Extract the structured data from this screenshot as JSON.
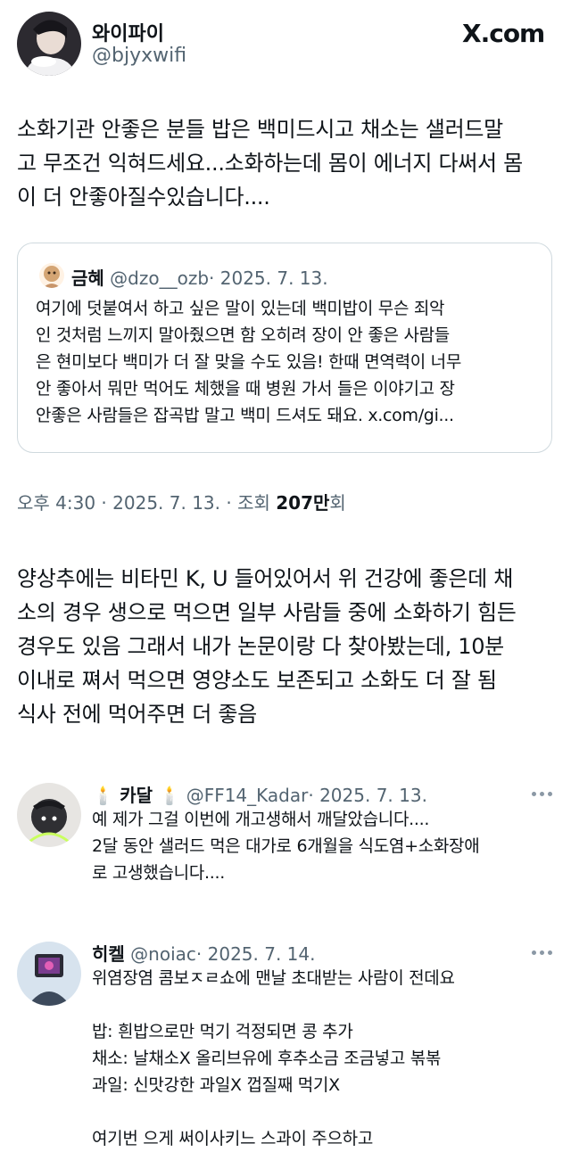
{
  "header": {
    "display_name": "와이파이",
    "handle": "@bjyxwifi",
    "brand": "X.com"
  },
  "post": {
    "lines": [
      "소화기관 안좋은 분들 밥은 백미드시고 채소는 샐러드말",
      "고 무조건 익혀드세요...소화하는데 몸이 에너지 다써서 몸",
      "이 더 안좋아질수있습니다...."
    ],
    "meta_time": "오후 4:30 · 2025. 7. 13. · 조회 ",
    "meta_views": "207만",
    "meta_unit": "회"
  },
  "quote": {
    "name": "금혜",
    "handle": "@dzo__ozb",
    "date": "· 2025. 7. 13.",
    "lines": [
      "여기에 덧붙여서 하고 싶은 말이 있는데 백미밥이 무슨 죄악",
      "인 것처럼 느끼지 말아줬으면 함 오히려 장이 안 좋은 사람들",
      "은 현미보다 백미가 더 잘 맞을 수도 있음! 한때 면역력이 너무",
      "안 좋아서 뭐만 먹어도 체했을 때 병원 가서 들은 이야기고 장",
      "안좋은 사람들은 잡곡밥 말고 백미 드셔도 돼요. x.com/gi..."
    ]
  },
  "reply_main": {
    "lines": [
      "양상추에는 비타민 K, U 들어있어서 위 건강에 좋은데 채",
      "소의 경우 생으로 먹으면 일부 사람들 중에 소화하기 힘든",
      "경우도 있음 그래서 내가 논문이랑 다 찾아봤는데, 10분",
      "이내로 쪄서 먹으면 영양소도 보존되고 소화도 더 잘 됨",
      "식사 전에 먹어주면 더 좋음"
    ]
  },
  "reply1": {
    "name": "카달",
    "handle": "@FF14_Kadar",
    "date": "· 2025. 7. 13.",
    "lines": [
      "예 제가 그걸 이번에 개고생해서 깨달았습니다....",
      "2달 동안 샐러드 먹은 대가로 6개월을 식도염+소화장애",
      "로 고생했습니다...."
    ]
  },
  "reply2": {
    "name": "히켈",
    "handle": "@noiac",
    "date": "· 2025. 7. 14.",
    "lines": [
      "위염장염 콤보ㅈㄹ쇼에 맨날 초대받는 사람이 전데요",
      "",
      "밥: 흰밥으로만 먹기 걱정되면 콩 추가",
      "채소: 날채소X 올리브유에 후추소금 조금넣고 볶볶",
      "과일: 신맛강한 과일X 껍질째 먹기X",
      "",
      "여기번 으게 써이사키느 스과이 주으하고"
    ]
  }
}
